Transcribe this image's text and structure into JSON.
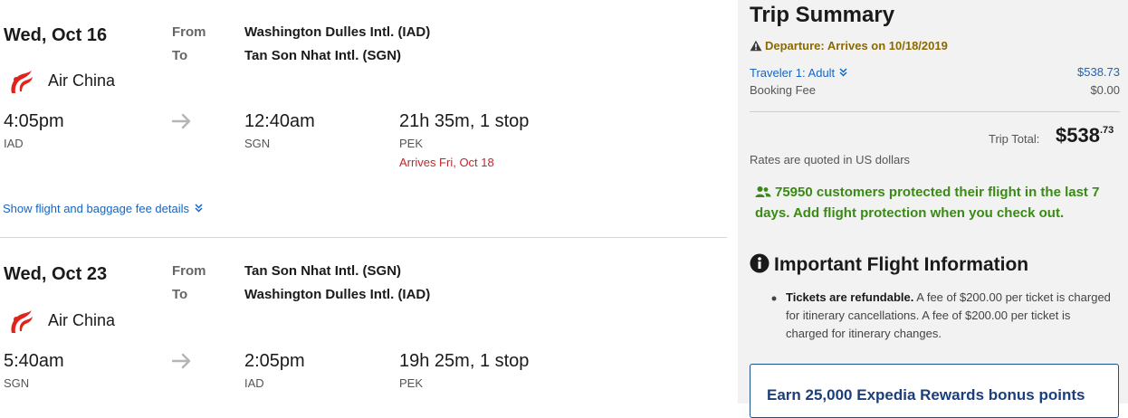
{
  "flights": [
    {
      "date": "Wed, Oct 16",
      "from_label": "From",
      "to_label": "To",
      "from_airport": "Washington Dulles Intl. (IAD)",
      "to_airport": "Tan Son Nhat Intl. (SGN)",
      "airline": "Air China",
      "depart_time": "4:05pm",
      "depart_code": "IAD",
      "arrive_time": "12:40am",
      "arrive_code": "SGN",
      "duration": "21h 35m, 1 stop",
      "stop_code": "PEK",
      "arrive_note": "Arrives Fri, Oct 18",
      "details_link": "Show flight and baggage fee details"
    },
    {
      "date": "Wed, Oct 23",
      "from_label": "From",
      "to_label": "To",
      "from_airport": "Tan Son Nhat Intl. (SGN)",
      "to_airport": "Washington Dulles Intl. (IAD)",
      "airline": "Air China",
      "depart_time": "5:40am",
      "depart_code": "SGN",
      "arrive_time": "2:05pm",
      "arrive_code": "IAD",
      "duration": "19h 25m, 1 stop",
      "stop_code": "PEK"
    }
  ],
  "summary": {
    "title": "Trip Summary",
    "departure_warning": "Departure: Arrives on 10/18/2019",
    "traveler_label": "Traveler 1: Adult",
    "traveler_price": "$538.73",
    "booking_fee_label": "Booking Fee",
    "booking_fee_value": "$0.00",
    "trip_total_label": "Trip Total:",
    "trip_total_main": "$538",
    "trip_total_cents": ".73",
    "rates_note": "Rates are quoted in US dollars",
    "protection_text": "75950 customers protected their flight in the last 7 days. Add flight protection when you check out.",
    "info_title": "Important Flight Information",
    "bullet_bold": "Tickets are refundable.",
    "bullet_rest": " A fee of $200.00 per ticket is charged for itinerary cancellations. A fee of $200.00 per ticket is charged for itinerary changes.",
    "promo_text": "Earn 25,000 Expedia Rewards bonus points"
  },
  "colors": {
    "link_blue": "#1665c1",
    "alert_red": "#c0262d",
    "protect_green": "#3a8a15",
    "warning_amber": "#8a6a00",
    "airline_red": "#e0241b"
  },
  "icons": [
    "air-china-logo-icon",
    "right-arrow-icon",
    "chevron-down-icon",
    "warning-icon",
    "people-icon",
    "info-icon"
  ]
}
